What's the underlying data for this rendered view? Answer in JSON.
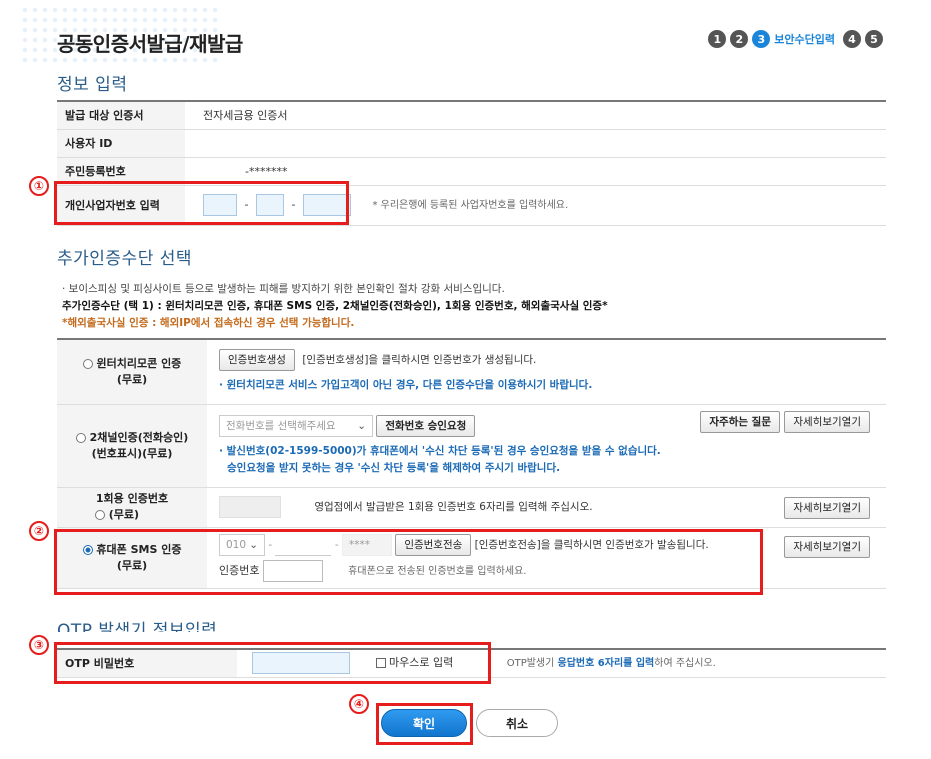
{
  "header": {
    "title": "공동인증서발급/재발급",
    "steps": [
      "1",
      "2",
      "3",
      "4",
      "5"
    ],
    "active_step_label": "보안수단입력"
  },
  "info_section": {
    "title": "정보 입력",
    "rows": [
      {
        "label": "발급 대상 인증서",
        "value": "전자세금용 인증서"
      },
      {
        "label": "사용자 ID",
        "value": ""
      },
      {
        "label": "주민등록번호",
        "value": "-*******"
      },
      {
        "label": "개인사업자번호 입력",
        "value": ""
      }
    ],
    "biz_hint": "* 우리은행에 등록된 사업자번호를 입력하세요.",
    "dash": "-"
  },
  "auth_section": {
    "title": "추가인증수단 선택",
    "note1": "· 보이스피싱 및 피싱사이트 등으로 발생하는 피해를 방지하기 위한 본인확인 절차 강화 서비스입니다.",
    "note2": "추가인증수단 (택 1) : 윈터치리모콘 인증, 휴대폰 SMS 인증, 2채널인증(전화승인), 1회용 인증번호, 해외출국사실 인증*",
    "note3": "*해외출국사실 인증 : 해외IP에서 접속하신 경우 선택 가능합니다.",
    "wintouch": {
      "label1": "윈터치리모콘 인증",
      "label2": "(무료)",
      "button": "인증번호생성",
      "desc": "[인증번호생성]을 클릭하시면 인증번호가 생성됩니다.",
      "note": "· 윈터치리모콘 서비스 가입고객이 아닌 경우, 다른 인증수단을 이용하시기 바랍니다."
    },
    "two_channel": {
      "label1": "2채널인증(전화승인)",
      "label2": "(번호표시)(무료)",
      "select_placeholder": "전화번호를 선택해주세요",
      "button": "전화번호 승인요청",
      "faq_button": "자주하는 질문",
      "detail_button": "자세히보기열기",
      "note1": "· 발신번호(02-1599-5000)가 휴대폰에서 '수신 차단 등록'된 경우 승인요청을 받을 수 없습니다.",
      "note2": "승인요청을 받지 못하는 경우 '수신 차단 등록'을 해제하여 주시기 바랍니다."
    },
    "otp_once": {
      "label1": "1회용 인증번호",
      "label2": "(무료)",
      "desc": "영업점에서 발급받은 1회용 인증번호 6자리를 입력해 주십시오.",
      "detail_button": "자세히보기열기"
    },
    "sms": {
      "label1": "휴대폰 SMS 인증",
      "label2": "(무료)",
      "prefix": "010",
      "masked": "****",
      "button": "인증번호전송",
      "desc": "[인증번호전송]을 클릭하시면 인증번호가 발송됩니다.",
      "code_label": "인증번호",
      "code_hint": "휴대폰으로 전송된 인증번호를 입력하세요.",
      "detail_button": "자세히보기열기"
    }
  },
  "otp_section": {
    "title": "OTP 발생기 정보입력",
    "label": "OTP 비밀번호",
    "mouse_checkbox": "마우스로 입력",
    "hint_prefix": "OTP발생기 ",
    "hint_bold": "응답번호 6자리를 입력",
    "hint_suffix": "하여 주십시오."
  },
  "annotations": [
    "①",
    "②",
    "③",
    "④"
  ],
  "actions": {
    "confirm": "확인",
    "cancel": "취소"
  },
  "colors": {
    "accent": "#1b86d9",
    "highlight": "#e61d1d",
    "orange_note": "#c46a1c"
  }
}
